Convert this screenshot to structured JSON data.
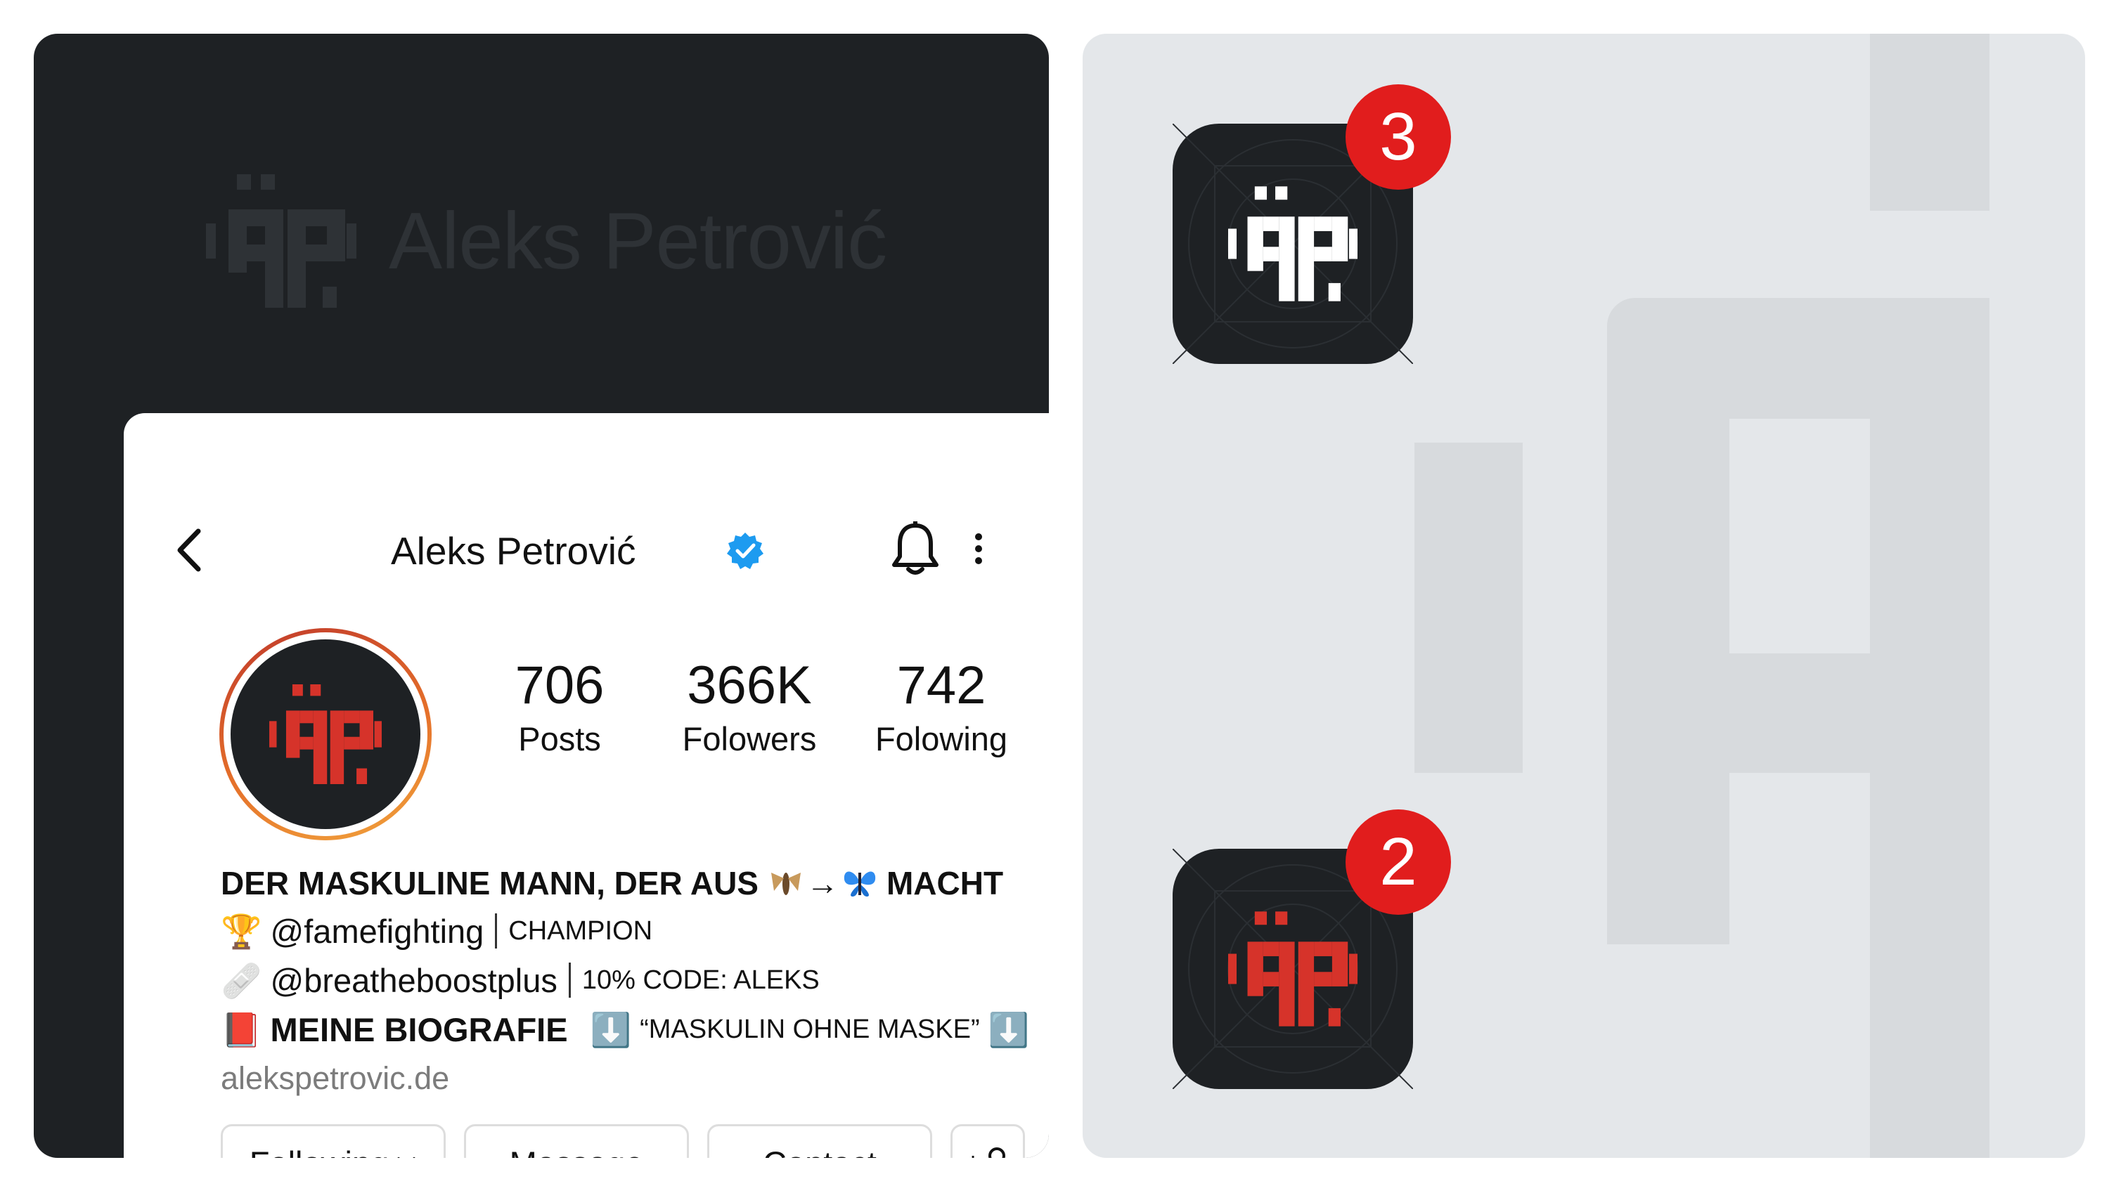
{
  "brand": {
    "name": "Aleks Petrović",
    "accent_color": "#d6332a",
    "dark_color": "#1e2124"
  },
  "profile": {
    "name": "Aleks Petrović",
    "verified": true,
    "stats": {
      "posts_value": "706",
      "posts_label": "Posts",
      "followers_value": "366K",
      "followers_label": "Folowers",
      "following_value": "742",
      "following_label": "Folowing"
    },
    "bio": {
      "title_part1": "DER MASKULINE MANN, DER AUS",
      "title_arrow": "→",
      "title_part2": "MACHT",
      "line1_emoji": "🏆",
      "line1_handle": "@famefighting",
      "line1_note": "CHAMPION",
      "line2_emoji": "🩹",
      "line2_handle": "@breatheboostplus",
      "line2_note": "10% CODE: ALEKS",
      "line3_emoji": "📕",
      "line3_title": "MEINE BIOGRAFIE",
      "line3_arrow_emoji": "⬇️",
      "line3_note": "“MASKULIN OHNE MASKE”",
      "link": "alekspetrovic.de"
    },
    "buttons": {
      "following": "Following",
      "message": "Massage",
      "contact": "Contact",
      "add_user": "+"
    }
  },
  "app_icons": [
    {
      "variant": "white-logo",
      "badge": "3"
    },
    {
      "variant": "red-logo",
      "badge": "2"
    }
  ],
  "colors": {
    "badge": "#e11d1d",
    "verified": "#1d9bf0",
    "background_light": "#e4e7ea"
  }
}
